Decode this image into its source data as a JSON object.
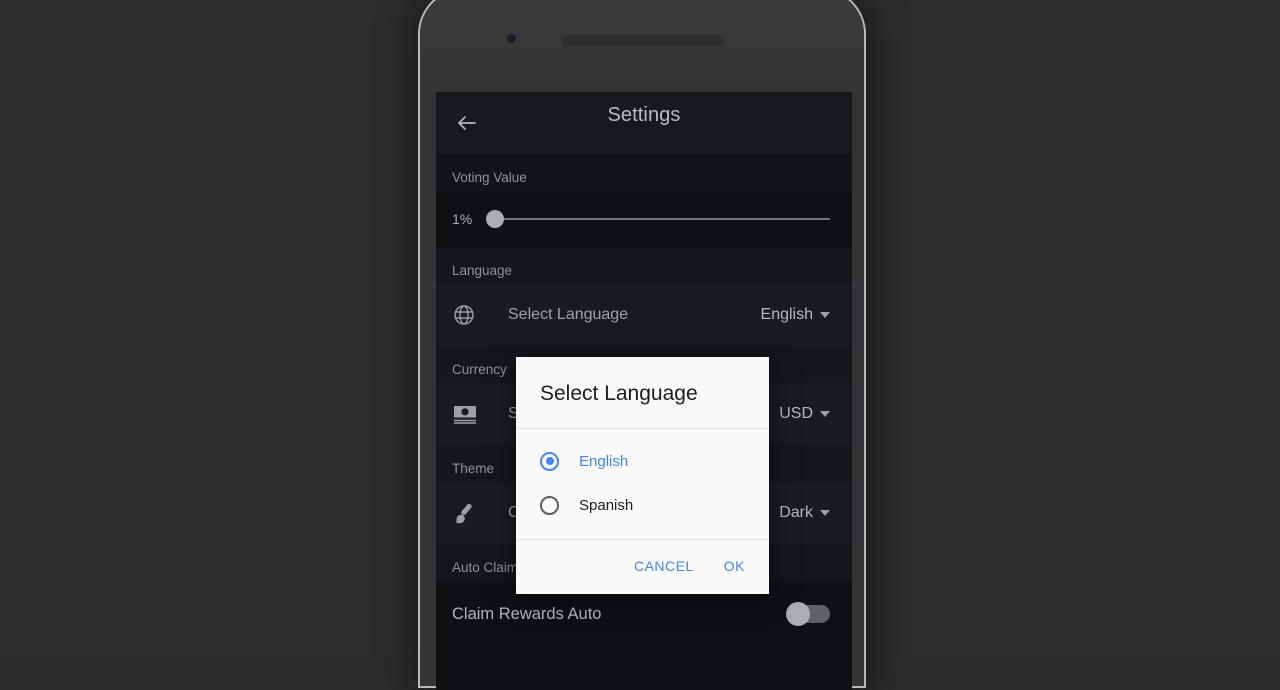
{
  "app": {
    "title": "Settings",
    "back_icon": "back-arrow-icon"
  },
  "sections": {
    "voting": {
      "header": "Voting Value",
      "slider_value": "1%",
      "slider_percent": 1
    },
    "language": {
      "header": "Language",
      "row_label": "Select Language",
      "row_value": "English",
      "icon": "globe-icon"
    },
    "currency": {
      "header": "Currency",
      "row_label": "Select Currency",
      "row_value": "USD",
      "icon": "money-icon"
    },
    "theme": {
      "header": "Theme",
      "row_label": "Change Theme",
      "row_value": "Dark",
      "icon": "brush-icon"
    },
    "auto_claim": {
      "header": "Auto Claim Rewards",
      "row_label": "Claim Rewards Auto",
      "toggle_state": "off"
    }
  },
  "dialog": {
    "title": "Select Language",
    "options": [
      {
        "label": "English",
        "selected": true
      },
      {
        "label": "Spanish",
        "selected": false
      }
    ],
    "cancel_label": "CANCEL",
    "ok_label": "OK"
  },
  "colors": {
    "accent": "#4285f4",
    "screen_bg": "#0d1114",
    "row_bg": "#161c21",
    "dialog_bg": "#fafafa"
  }
}
